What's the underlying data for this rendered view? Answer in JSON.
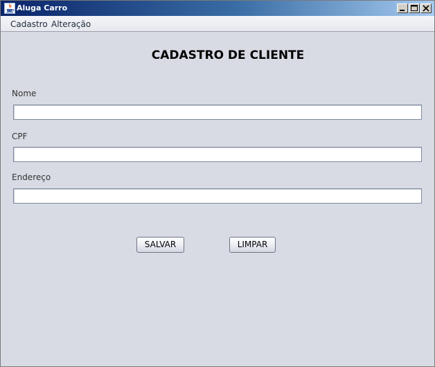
{
  "window": {
    "title": "Aluga Carro",
    "title_icon": "java-cup-icon",
    "controls": {
      "minimize_icon": "minimize-icon",
      "maximize_icon": "maximize-icon",
      "close_icon": "close-icon"
    }
  },
  "menubar": {
    "items": [
      {
        "label": "Cadastro"
      },
      {
        "label": "Alteração"
      }
    ]
  },
  "form": {
    "title": "CADASTRO DE CLIENTE",
    "fields": [
      {
        "label": "Nome",
        "value": ""
      },
      {
        "label": "CPF",
        "value": ""
      },
      {
        "label": "Endereço",
        "value": ""
      }
    ],
    "buttons": {
      "save_label": "SALVAR",
      "clear_label": "LIMPAR"
    }
  },
  "colors": {
    "titlebar_start": "#0a246a",
    "titlebar_end": "#a6caf0",
    "window_background": "#d8dbe3",
    "field_background": "#ffffff"
  }
}
